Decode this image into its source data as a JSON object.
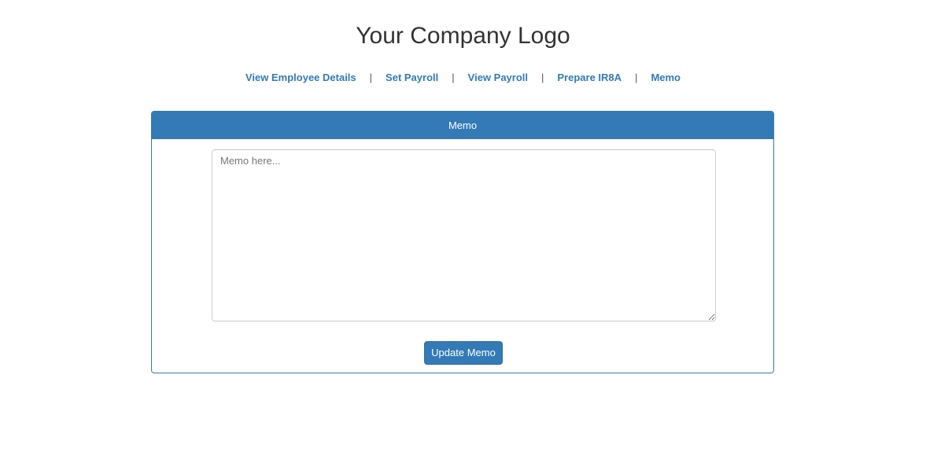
{
  "header": {
    "logo_text": "Your Company Logo"
  },
  "nav": {
    "separator": "|",
    "items": [
      {
        "label": "View Employee Details"
      },
      {
        "label": "Set Payroll"
      },
      {
        "label": "View Payroll"
      },
      {
        "label": "Prepare IR8A"
      },
      {
        "label": "Memo"
      }
    ]
  },
  "panel": {
    "title": "Memo",
    "memo_value": "",
    "memo_placeholder": "Memo here...",
    "update_button_label": "Update Memo"
  },
  "colors": {
    "primary": "#337ab7",
    "text": "#333333",
    "border": "#cccccc"
  }
}
